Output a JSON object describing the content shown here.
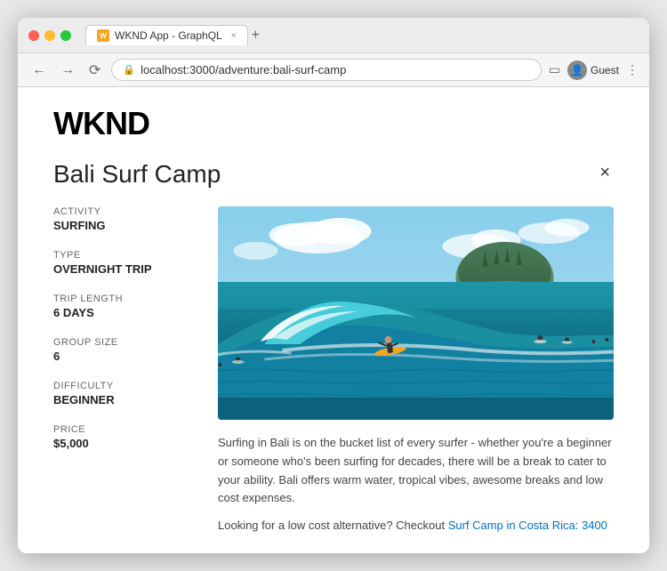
{
  "browser": {
    "tab_title": "WKND App - GraphQL",
    "url": "localhost:3000/adventure:bali-surf-camp",
    "favicon_text": "W",
    "user_label": "Guest"
  },
  "header": {
    "logo": "WKND"
  },
  "page": {
    "title": "Bali Surf Camp",
    "close_label": "×"
  },
  "details": [
    {
      "label": "ACTIVITY",
      "value": "SURFING"
    },
    {
      "label": "TYPE",
      "value": "OVERNIGHT TRIP"
    },
    {
      "label": "TRIP LENGTH",
      "value": "6 DAYS"
    },
    {
      "label": "GROUP SIZE",
      "value": "6"
    },
    {
      "label": "DIFFICULTY",
      "value": "BEGINNER"
    },
    {
      "label": "PRICE",
      "value": "$5,000"
    }
  ],
  "description": "Surfing in Bali is on the bucket list of every surfer - whether you're a beginner or someone who's been surfing for decades, there will be a break to cater to your ability. Bali offers warm water, tropical vibes, awesome breaks and low cost expenses.",
  "cta": {
    "prefix": "Looking for a low cost alternative? Checkout ",
    "link_text": "Surf Camp in Costa Rica: 3400",
    "link_href": "#"
  }
}
